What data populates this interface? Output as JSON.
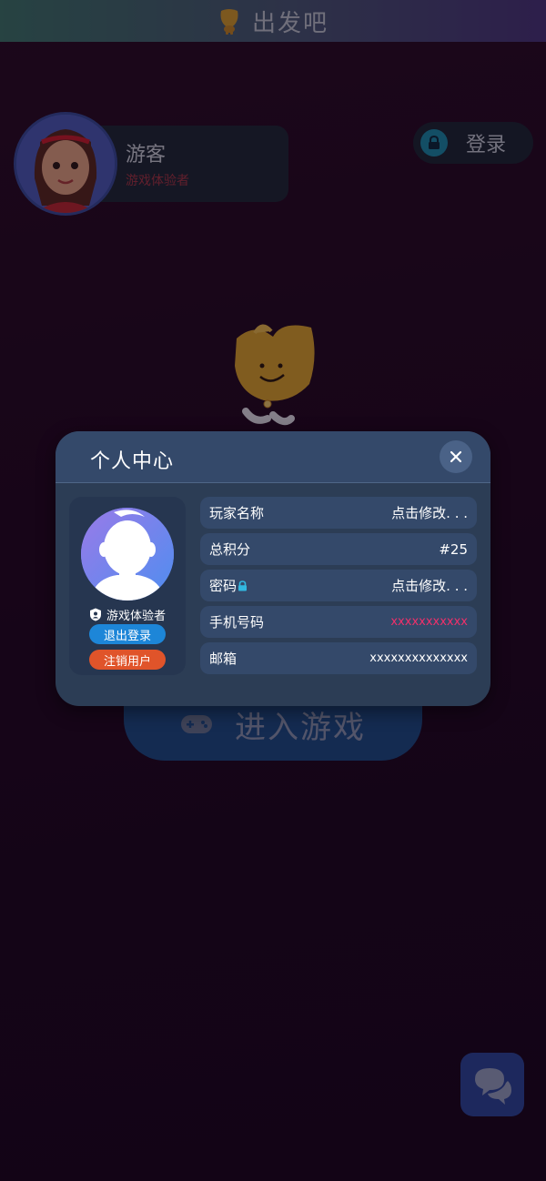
{
  "app": {
    "title": "出发吧",
    "logo_icon": "mascot-logo-icon"
  },
  "user_card": {
    "name": "游客",
    "role": "游戏体验者"
  },
  "login_button": {
    "label": "登录",
    "icon": "lock-icon"
  },
  "main": {
    "enter_game_label": "进入游戏",
    "enter_game_icon": "gamepad-icon",
    "chat_icon": "chat-bubbles-icon"
  },
  "modal": {
    "title": "个人中心",
    "close_icon": "close-icon",
    "profile": {
      "role": "游戏体验者",
      "logout_label": "退出登录",
      "deregister_label": "注销用户"
    },
    "rows": [
      {
        "key": "玩家名称",
        "value": "点击修改. . ."
      },
      {
        "key": "总积分",
        "value": "#25"
      },
      {
        "key": "密码",
        "value": "点击修改. . ."
      },
      {
        "key": "手机号码",
        "value": "xxxxxxxxxxx"
      },
      {
        "key": "邮箱",
        "value": "xxxxxxxxxxxxxx"
      }
    ]
  },
  "colors": {
    "accent_blue": "#1d86d8",
    "danger_orange": "#e0542a",
    "phone_pink": "#f0306a",
    "modal_bg": "#2c3d55"
  }
}
